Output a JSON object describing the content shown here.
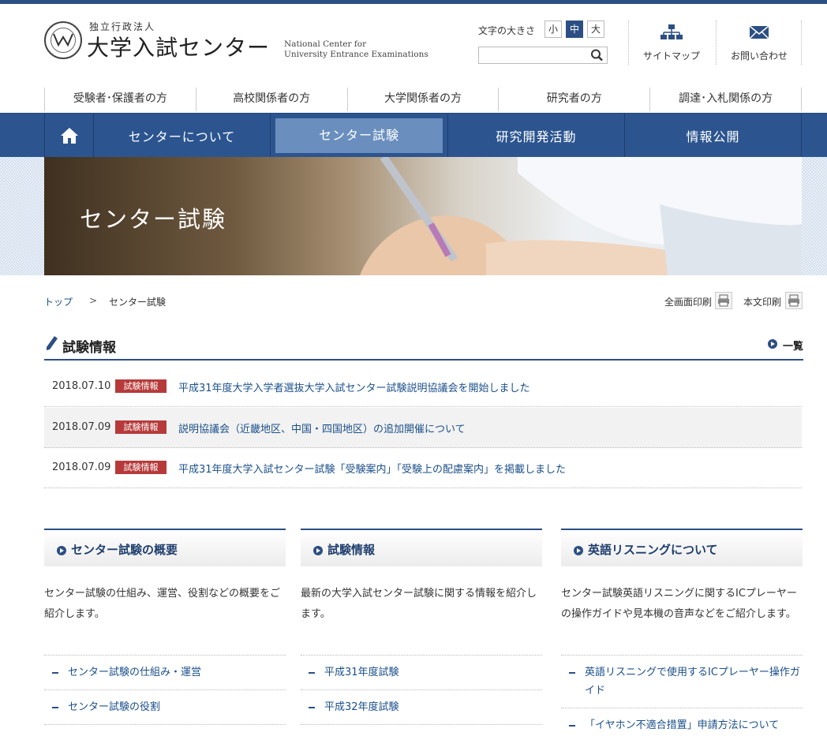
{
  "header": {
    "org_sub": "独立行政法人",
    "org_title": "大学入試センター",
    "org_en_1": "National Center for",
    "org_en_2": "University Entrance Examinations",
    "font_size_label": "文字の大きさ",
    "font_sizes": [
      "小",
      "中",
      "大"
    ],
    "search_placeholder": "",
    "sitemap": "サイトマップ",
    "contact": "お問い合わせ"
  },
  "audience_nav": [
    "受験者･保護者の方",
    "高校関係者の方",
    "大学関係者の方",
    "研究者の方",
    "調達･入札関係の方"
  ],
  "main_nav": [
    "センターについて",
    "センター試験",
    "研究開発活動",
    "情報公開"
  ],
  "hero": {
    "title": "センター試験"
  },
  "breadcrumb": {
    "top": "トップ",
    "sep": ">",
    "current": "センター試験"
  },
  "print": {
    "full": "全画面印刷",
    "body": "本文印刷"
  },
  "news": {
    "title": "試験情報",
    "list_all": "一覧",
    "items": [
      {
        "date": "2018.07.10",
        "tag": "試験情報",
        "text": "平成31年度大学入学者選抜大学入試センター試験説明協議会を開始しました"
      },
      {
        "date": "2018.07.09",
        "tag": "試験情報",
        "text": "説明協議会（近畿地区、中国・四国地区）の追加開催について"
      },
      {
        "date": "2018.07.09",
        "tag": "試験情報",
        "text": "平成31年度大学入試センター試験「受験案内」「受験上の配慮案内」を掲載しました"
      }
    ]
  },
  "columns": [
    {
      "title": "センター試験の概要",
      "desc": "センター試験の仕組み、運営、役割などの概要をご紹介します。",
      "links": [
        "センター試験の仕組み・運営",
        "センター試験の役割"
      ]
    },
    {
      "title": "試験情報",
      "desc": "最新の大学入試センター試験に関する情報を紹介します。",
      "links": [
        "平成31年度試験",
        "平成32年度試験"
      ]
    },
    {
      "title": "英語リスニングについて",
      "desc": "センター試験英語リスニングに関するICプレーヤーの操作ガイドや見本機の音声などをご紹介します。",
      "links": [
        "英語リスニングで使用するICプレーヤー操作ガイド",
        "「イヤホン不適合措置」申請方法について"
      ]
    }
  ],
  "colors": {
    "brand": "#2c4f83",
    "nav": "#2c5590",
    "nav_active": "#6a8fbe",
    "tag": "#b73a3a",
    "link": "#1a4f8a"
  }
}
